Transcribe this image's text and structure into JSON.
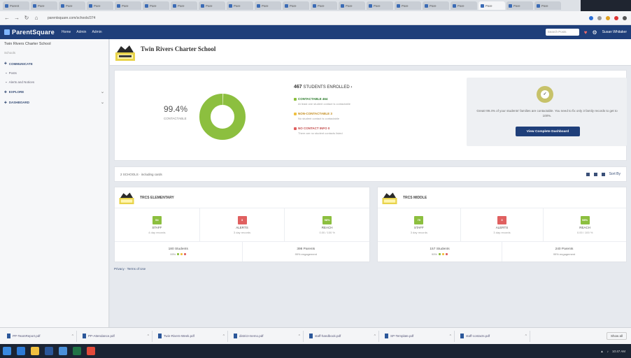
{
  "browser": {
    "tabs": [
      "Parent",
      "Pare",
      "Pare",
      "Pare",
      "Pare",
      "Pare",
      "Pare",
      "Pare",
      "Pare",
      "Pare",
      "Pare",
      "Pare",
      "Pare",
      "Pare",
      "Pare",
      "Pare",
      "Pare",
      "Pare",
      "Pare",
      "Pare"
    ],
    "url": "parentsquare.com/schools/374"
  },
  "app": {
    "logo": "ParentSquare",
    "nav": [
      "Home",
      "Admin",
      "Admin"
    ],
    "search_placeholder": "Search Posts",
    "user": "Susan Whitaker"
  },
  "sidebar": {
    "school": "Twin Rivers Charter School",
    "subtitle": "Schools",
    "items": [
      {
        "label": "COMMUNICATE",
        "section": true
      },
      {
        "label": "Posts",
        "section": false
      },
      {
        "label": "Alerts and Notices",
        "section": false
      },
      {
        "label": "EXPLORE",
        "section": true
      },
      {
        "label": "DASHBOARD",
        "section": true
      }
    ]
  },
  "school": {
    "name": "Twin Rivers Charter School"
  },
  "summary": {
    "percent": "99.4%",
    "percent_label": "CONTACTABLE",
    "total": "467",
    "total_label": "STUDENTS ENROLLED",
    "contactable": "CONTACTABLE 464",
    "contactable_desc": "At least one student contact is contactable",
    "noncontactable": "NON-CONTACTABLE 3",
    "noncontactable_desc": "No student contact is contactable",
    "nocontact": "NO CONTACT INFO 0",
    "nocontact_desc": "There are no student contacts listed",
    "cta_text": "Great! 99.4% of your students' families are contactable. You need to fix only 3 family records to get to 100%.",
    "cta_button": "View Complete Dashboard"
  },
  "filter": {
    "text": "2 SCHOOLS · including cards",
    "sort": "Sort By"
  },
  "cards": [
    {
      "name": "TRCS ELEMENTARY",
      "metrics": [
        {
          "badge": "54",
          "label": "STAFF",
          "sub": "4 day records"
        },
        {
          "badge": "3",
          "label": "ALERTS",
          "sub": "3 day records"
        },
        {
          "badge": "98%",
          "label": "REACH",
          "sub": "0.00 / 100 %"
        }
      ],
      "students": "180 Students",
      "students_sub": "99%",
      "parents": "398 Parents",
      "parents_sub": "99% engagement"
    },
    {
      "name": "TRCS MIDDLE",
      "metrics": [
        {
          "badge": "70",
          "label": "STAFF",
          "sub": "3 day records"
        },
        {
          "badge": "3",
          "label": "ALERTS",
          "sub": "3 day records"
        },
        {
          "badge": "98%",
          "label": "REACH",
          "sub": "0.00 / 100 %"
        }
      ],
      "students": "157 Students",
      "students_sub": "99%",
      "parents": "240 Parents",
      "parents_sub": "99% engagement"
    }
  ],
  "privacy": "Privacy · Terms of Use",
  "downloads": [
    "PP-TeamReport.pdf",
    "PP-Attendance.pdf",
    "Twin-Rivers-Week.pdf",
    "district-memo.pdf",
    "staff-handbook.pdf",
    "SP-Template.pdf",
    "staff-contacts.pdf"
  ],
  "downloads_show_all": "Show all",
  "tray_time": "10:47 AM",
  "colors": {
    "brand": "#1f3f7a",
    "donut": "#8cbf3f",
    "warn": "#f0a040",
    "alert": "#e06060"
  }
}
